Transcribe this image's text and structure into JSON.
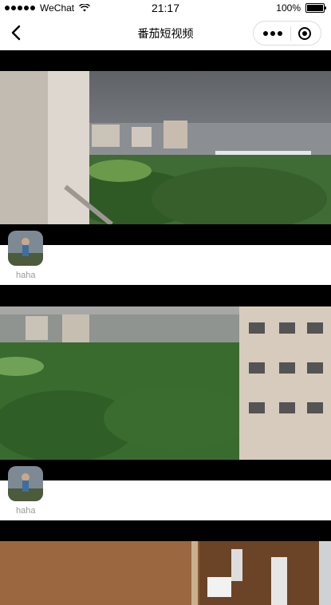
{
  "status_bar": {
    "carrier": "WeChat",
    "time": "21:17",
    "battery": "100%"
  },
  "nav": {
    "title": "番茄短视频"
  },
  "videos": [
    {
      "username": "haha"
    },
    {
      "username": "haha"
    }
  ]
}
